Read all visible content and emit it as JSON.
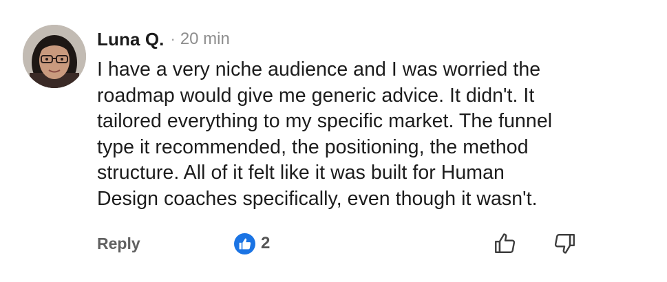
{
  "comment": {
    "author": "Luna Q.",
    "separator": "·",
    "timestamp": "20 min",
    "lines": [
      "I have a very niche audience and I was worried the",
      "roadmap would give me generic advice. It didn't. It",
      "tailored everything to my specific market. The funnel",
      "type it recommended, the positioning, the method",
      "structure. All of it felt like it was built for Human",
      "Design coaches specifically, even though it wasn't."
    ]
  },
  "actions": {
    "reply_label": "Reply",
    "like_count": "2",
    "thumb_up_icon": "thumb-up-icon",
    "thumb_down_icon": "thumb-down-icon",
    "like_badge_icon": "like-badge-icon"
  },
  "colors": {
    "like_badge": "#1b74e4",
    "text": "#1c1c1c",
    "muted": "#8e8e8e"
  }
}
